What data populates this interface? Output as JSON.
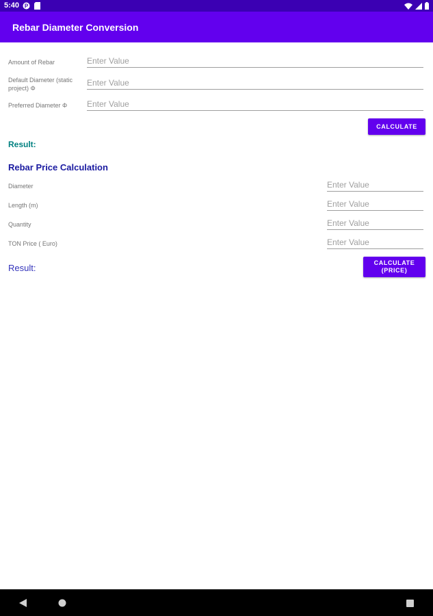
{
  "status_bar": {
    "time": "5:40"
  },
  "app_bar": {
    "title": "Rebar Diameter Conversion"
  },
  "conversion": {
    "fields": [
      {
        "label": "Amount of Rebar",
        "placeholder": "Enter Value",
        "value": ""
      },
      {
        "label": "Default Diameter (static project) Φ",
        "placeholder": "Enter Value",
        "value": ""
      },
      {
        "label": "Preferred Diameter Φ",
        "placeholder": "Enter Value",
        "value": ""
      }
    ],
    "calculate_label": "CALCULATE",
    "result_label": "Result:"
  },
  "price": {
    "title": "Rebar Price Calculation",
    "fields": [
      {
        "label": "Diameter",
        "placeholder": "Enter Value",
        "value": ""
      },
      {
        "label": "Length (m)",
        "placeholder": "Enter Value",
        "value": ""
      },
      {
        "label": "Quantity",
        "placeholder": "Enter Value",
        "value": ""
      },
      {
        "label": "TON Price ( Euro)",
        "placeholder": "Enter Value",
        "value": ""
      }
    ],
    "calculate_label_line1": "CALCULATE",
    "calculate_label_line2": "(PRICE)",
    "result_label": "Result:"
  },
  "colors": {
    "status_bar": "#3b00b3",
    "app_bar": "#6200ee",
    "button": "#6200ee",
    "result_teal": "#008080",
    "section_title": "#1a1aa0"
  }
}
